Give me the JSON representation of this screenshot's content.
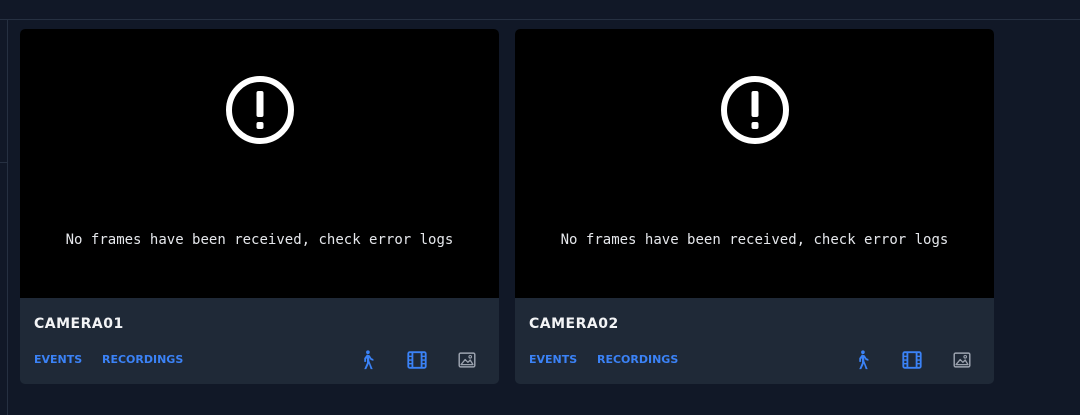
{
  "colors": {
    "page_bg": "#111827",
    "card_bg": "#1f2937",
    "viewport_bg": "#000000",
    "accent": "#3b82f6",
    "muted_icon": "#9ca3af"
  },
  "cameras": [
    {
      "name": "CAMERA01",
      "message": "No frames have been received, check error logs",
      "alert_icon": "alert-circle-icon",
      "links": {
        "events": "EVENTS",
        "recordings": "RECORDINGS"
      },
      "tools": [
        "motion-walk-icon",
        "film-icon",
        "image-snapshot-icon"
      ]
    },
    {
      "name": "CAMERA02",
      "message": "No frames have been received, check error logs",
      "alert_icon": "alert-circle-icon",
      "links": {
        "events": "EVENTS",
        "recordings": "RECORDINGS"
      },
      "tools": [
        "motion-walk-icon",
        "film-icon",
        "image-snapshot-icon"
      ]
    }
  ]
}
